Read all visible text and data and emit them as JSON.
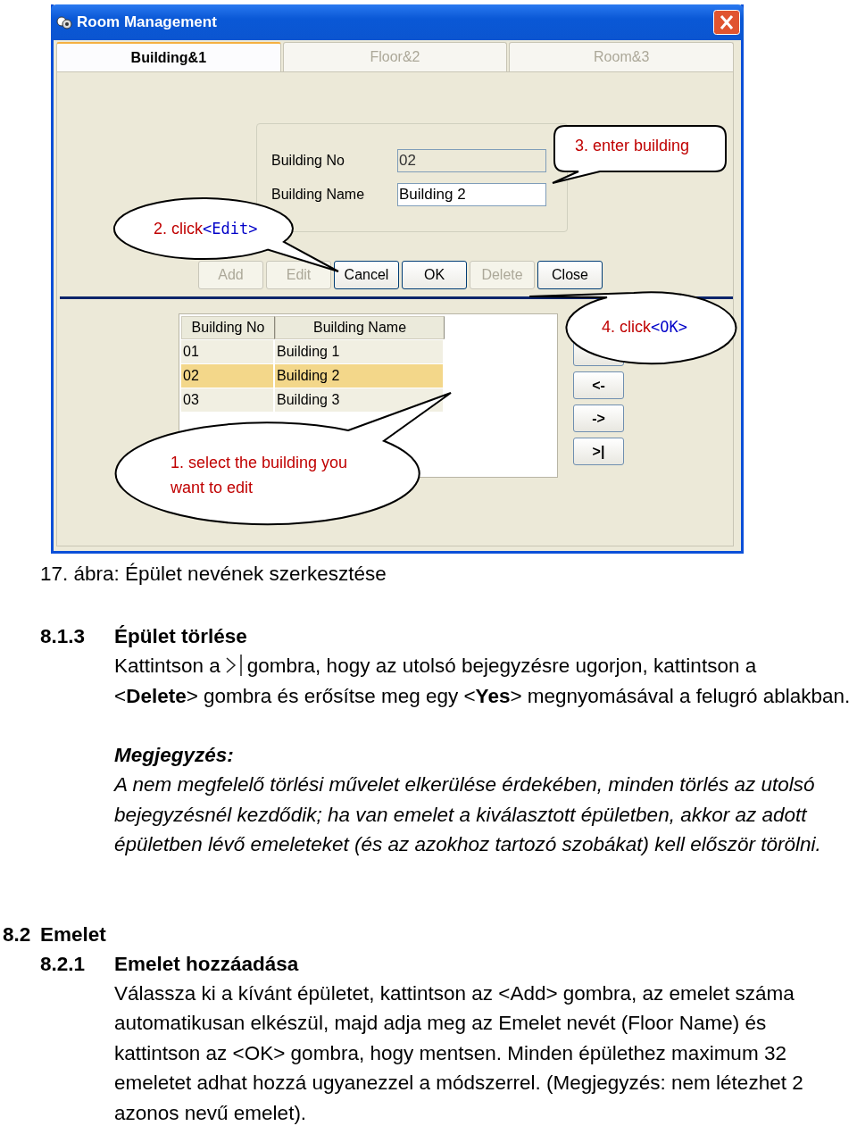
{
  "window": {
    "title": "Room Management"
  },
  "tabs": [
    {
      "label": "Building&1",
      "selected": true
    },
    {
      "label": "Floor&2",
      "selected": false
    },
    {
      "label": "Room&3",
      "selected": false
    }
  ],
  "fields": [
    {
      "label": "Building No",
      "value": "02",
      "disabled": true
    },
    {
      "label": "Building Name",
      "value": "Building 2",
      "disabled": false
    }
  ],
  "buttons": [
    {
      "label": "Add",
      "disabled": true
    },
    {
      "label": "Edit",
      "disabled": true
    },
    {
      "label": "Cancel",
      "disabled": false
    },
    {
      "label": "OK",
      "disabled": false
    },
    {
      "label": "Delete",
      "disabled": true
    },
    {
      "label": "Close",
      "disabled": false
    }
  ],
  "grid": {
    "columns": [
      "Building No",
      "Building Name"
    ],
    "rows": [
      {
        "cells": [
          "01",
          "Building 1"
        ],
        "selected": false
      },
      {
        "cells": [
          "02",
          "Building 2"
        ],
        "selected": true
      },
      {
        "cells": [
          "03",
          "Building 3"
        ],
        "selected": false
      }
    ]
  },
  "nav_buttons": [
    "<-",
    "->",
    ">|"
  ],
  "callouts": [
    {
      "text": "3. enter building"
    },
    {
      "text": "2. click",
      "key": "<Edit>"
    },
    {
      "text": "4. click",
      "key": "<OK>"
    },
    {
      "text": "1. select the building you want to edit"
    }
  ],
  "document": {
    "caption": "17. ábra: Épület nevének szerkesztése",
    "section": {
      "number": "8.1.3",
      "title": "Épület törlése",
      "before": "Kattintson a",
      "after": "gombra, hogy az utolsó bejegyzésre ugorjon, kattintson a",
      "line2": "<**Delete**> gombra és erősítse meg egy <**Yes**> megnyomásával a felugró ablakban.",
      "note_title": "Megjegyzés:",
      "note": "A nem megfelelő törlési művelet elkerülése érdekében, minden törlés az utolsó bejegyzésnél kezdődik; ha van emelet a kiválasztott épületben, akkor az adott épületben lévő emeleteket (és az azokhoz tartozó szobákat) kell először törölni."
    },
    "chapter": {
      "number": "8.2",
      "title": "Emelet"
    },
    "subsection": {
      "number": "8.2.1",
      "title": "Emelet hozzáadása",
      "text": "Válassza ki a kívánt épületet, kattintson az <Add> gombra, az emelet száma automatikusan elkészül, majd adja meg az Emelet nevét (Floor Name) és kattintson az <OK> gombra, hogy mentsen. Minden épülethez maximum 32 emeletet adhat hozzá ugyanezzel a módszerrel. (Megjegyzés: nem létezhet 2 azonos nevű emelet)."
    }
  }
}
